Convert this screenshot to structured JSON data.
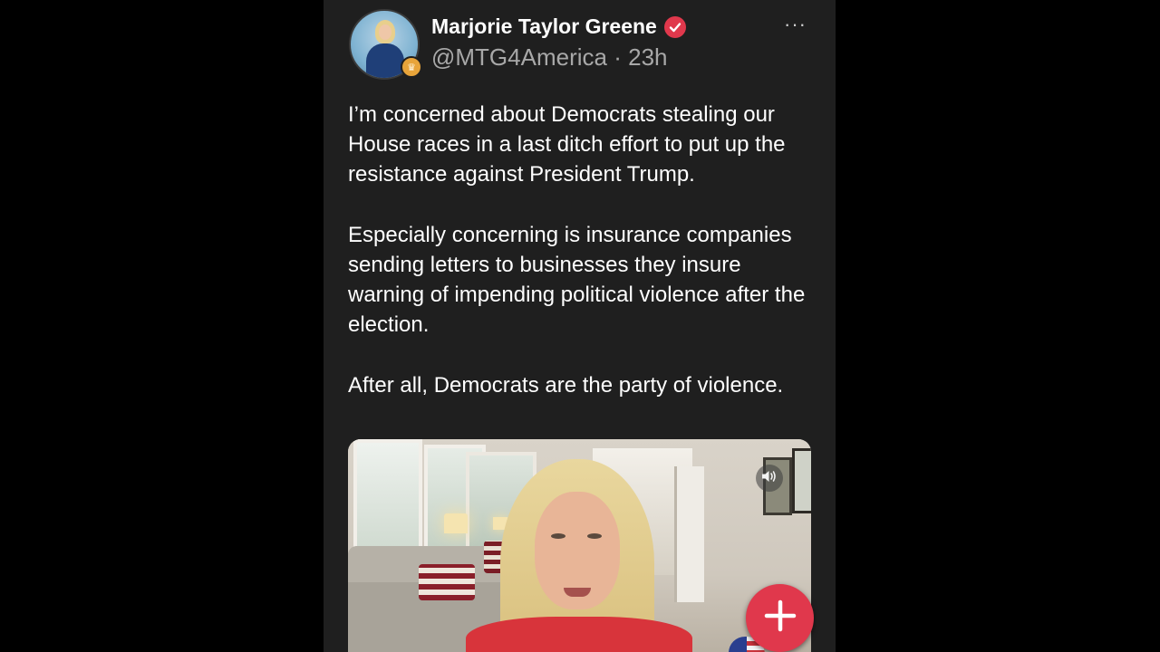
{
  "post": {
    "author": {
      "name": "Marjorie Taylor Greene",
      "handle": "@MTG4America",
      "separator": "·",
      "time": "23h"
    },
    "paragraphs": [
      "I’m concerned about Democrats stealing our House races in a last ditch effort to put up the resistance against President Trump.",
      "Especially concerning is insurance companies sending letters to businesses they insure warning of impending political violence after the election.",
      "After all, Democrats are the party of violence."
    ],
    "more_icon": "···",
    "media": {
      "type": "video",
      "volume_icon": "volume-icon"
    }
  },
  "icons": {
    "verified": "verified-icon",
    "avatar_badge": "crown-badge-icon",
    "fab": "plus-icon"
  },
  "colors": {
    "background": "#000000",
    "panel": "#1f1f1f",
    "accent_red": "#e0384c",
    "meta_gray": "#a8a8a8",
    "badge_gold": "#e8a43a"
  }
}
